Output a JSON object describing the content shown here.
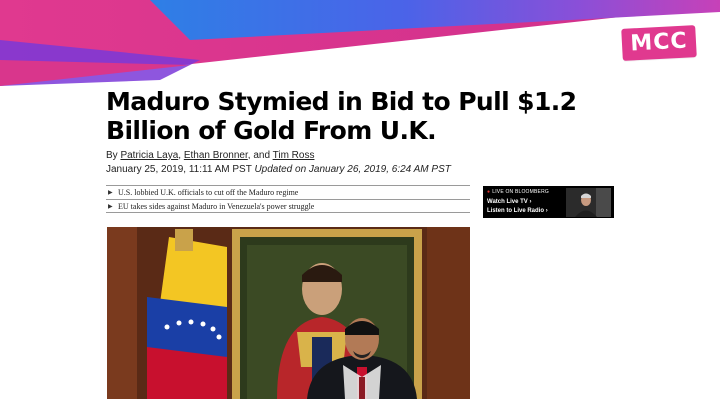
{
  "brand": {
    "logo_text": "MCC",
    "accent_color": "#e0398f"
  },
  "article": {
    "headline": "Maduro Stymied in Bid to Pull $1.2 Billion of Gold From U.K.",
    "byline": {
      "prefix": "By ",
      "authors": [
        "Patricia Laya",
        "Ethan Bronner",
        "Tim Ross"
      ],
      "sep1": ", ",
      "sep2": ", and "
    },
    "published": "January 25, 2019, 11:11 AM PST",
    "updated": "Updated on January 26, 2019, 6:24 AM PST"
  },
  "related_links": [
    {
      "text": "U.S. lobbied U.K. officials to cut off the Maduro regime"
    },
    {
      "text": "EU takes sides against Maduro in Venezuela's power struggle"
    }
  ],
  "live_widget": {
    "label": "LIVE ON BLOOMBERG",
    "watch": "Watch Live TV",
    "listen": "Listen to Live Radio",
    "chevron": "›",
    "live_dot": "●"
  },
  "icons": {
    "bullet": "arrow-right-icon"
  },
  "colors": {
    "banner_pink": "#e0398f",
    "banner_purple": "#7a38d8",
    "banner_blue": "#4b63e8",
    "flag_yellow": "#f3c623",
    "flag_blue": "#1a3fa6",
    "flag_red": "#c8102e"
  }
}
